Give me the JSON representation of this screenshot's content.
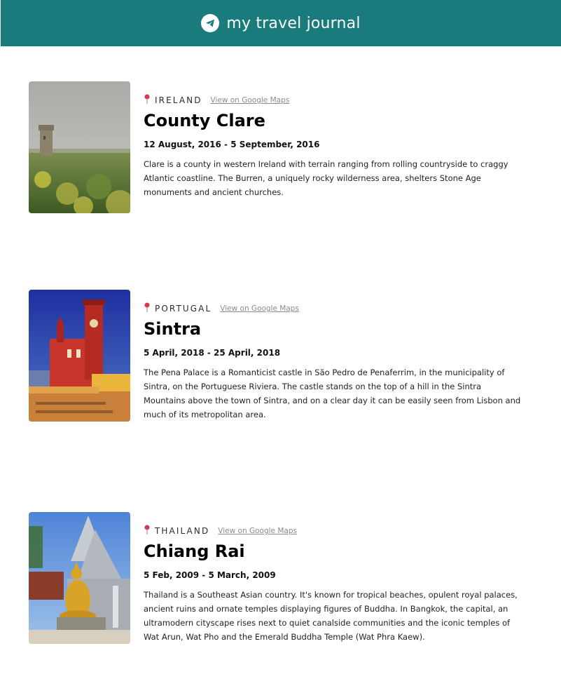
{
  "header": {
    "title": "my travel journal",
    "icon": "paper-plane-icon",
    "bg_color": "#197b7b"
  },
  "entries": [
    {
      "country": "IRELAND",
      "maps_link": "View on Google Maps",
      "place": "County Clare",
      "dates": "12 August, 2016 - 5 September, 2016",
      "description": "Clare is a county in western Ireland with terrain ranging from rolling countryside to craggy Atlantic coastline. The Burren, a uniquely rocky wilderness area, shelters Stone Age monuments and ancient churches."
    },
    {
      "country": "PORTUGAL",
      "maps_link": "View on Google Maps",
      "place": "Sintra",
      "dates": "5 April, 2018 - 25 April, 2018",
      "description": "The Pena Palace is a Romanticist castle in São Pedro de Penaferrim, in the municipality of Sintra, on the Portuguese Riviera. The castle stands on the top of a hill in the Sintra Mountains above the town of Sintra, and on a clear day it can be easily seen from Lisbon and much of its metropolitan area."
    },
    {
      "country": "THAILAND",
      "maps_link": "View on Google Maps",
      "place": "Chiang Rai",
      "dates": "5 Feb, 2009 - 5 March, 2009",
      "description": "Thailand is a Southeast Asian country. It's known for tropical beaches, opulent royal palaces, ancient ruins and ornate temples displaying figures of Buddha. In Bangkok, the capital, an ultramodern cityscape rises next to quiet canalside communities and the iconic temples of Wat Arun, Wat Pho and the Emerald Buddha Temple (Wat Phra Kaew)."
    }
  ]
}
